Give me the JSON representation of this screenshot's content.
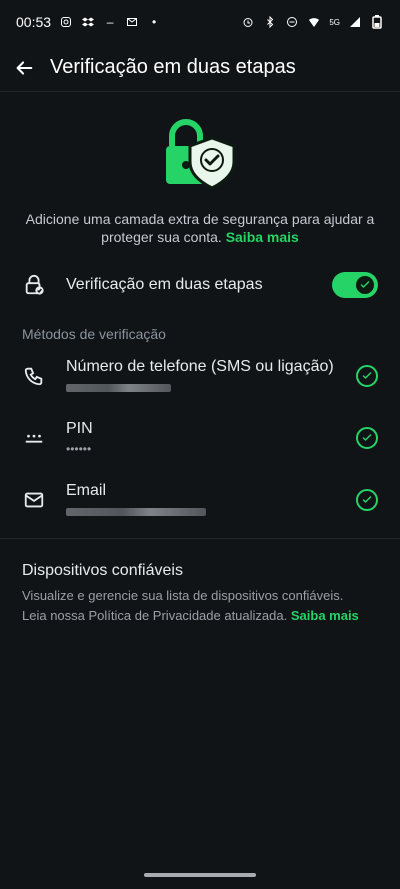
{
  "status_bar": {
    "time": "00:53",
    "network": "5G"
  },
  "app_bar": {
    "title": "Verificação em duas etapas"
  },
  "intro": {
    "text": "Adicione uma camada extra de segurança para ajudar a proteger sua conta.",
    "link": "Saiba mais"
  },
  "toggle_row": {
    "label": "Verificação em duas etapas",
    "enabled": true
  },
  "methods": {
    "section_label": "Métodos de verificação",
    "items": [
      {
        "label": "Número de telefone (SMS ou ligação)",
        "detail": "",
        "icon": "phone-icon"
      },
      {
        "label": "PIN",
        "detail": "••••••",
        "icon": "pin-icon"
      },
      {
        "label": "Email",
        "detail": "",
        "icon": "email-icon"
      }
    ]
  },
  "trusted": {
    "heading": "Dispositivos confiáveis",
    "description": "Visualize e gerencie sua lista de dispositivos confiáveis.",
    "privacy": "Leia nossa Política de Privacidade atualizada.",
    "link": "Saiba mais"
  },
  "colors": {
    "background": "#111417",
    "accent": "#25d366"
  }
}
